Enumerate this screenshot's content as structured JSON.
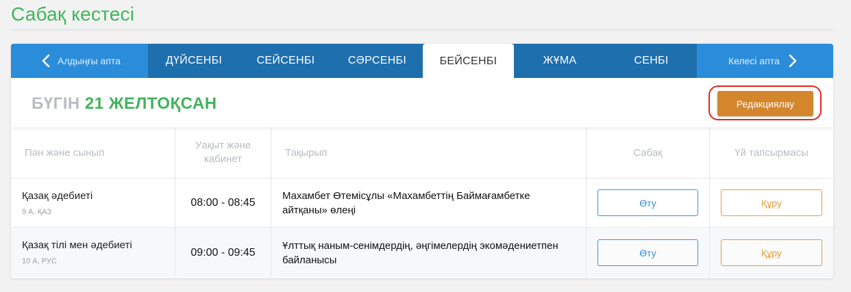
{
  "page": {
    "title": "Сабақ кестесі"
  },
  "week_nav": {
    "prev_label": "Алдыңғы апта",
    "next_label": "Келесі апта",
    "days": [
      "ДҮЙСЕНБІ",
      "СЕЙСЕНБІ",
      "СӘРСЕНБІ",
      "БЕЙСЕНБІ",
      "ЖҰМА",
      "СЕНБІ"
    ],
    "active_day": "БЕЙСЕНБІ"
  },
  "today": {
    "prefix": "БҮГІН",
    "date": "21 ЖЕЛТОҚСАН",
    "edit_label": "Редакциялау"
  },
  "table": {
    "headers": {
      "subject": "Пән және сынып",
      "time": "Уақыт және кабинет",
      "topic": "Тақырып",
      "lesson": "Сабақ",
      "homework": "Үй тапсырмасы"
    },
    "rows": [
      {
        "subject": "Қазақ әдебиеті",
        "class": "9 А, ҚАЗ",
        "time": "08:00 - 08:45",
        "topic": "Махамбет Өтемісұлы «Махамбеттің Баймағамбетке айтқаны» өлеңі",
        "lesson_button": "Өту",
        "homework_button": "Құру"
      },
      {
        "subject": "Қазақ тілі мен әдебиеті",
        "class": "10 А, РУС",
        "time": "09:00 - 09:45",
        "topic": "Ұлттық наным-сенімдердің, әңгімелердің экомәдениетпен байланысы",
        "lesson_button": "Өту",
        "homework_button": "Құру"
      }
    ]
  },
  "colors": {
    "brand_green": "#3fb55a",
    "nav_dark": "#1e6fae",
    "nav_light": "#2b8dda",
    "edit_orange": "#d4862c",
    "highlight_red": "#e0241d",
    "go_blue": "#3a8fd8",
    "make_orange": "#e49a3c"
  },
  "icons": {
    "prev": "chevron-left-icon",
    "next": "chevron-right-icon"
  }
}
